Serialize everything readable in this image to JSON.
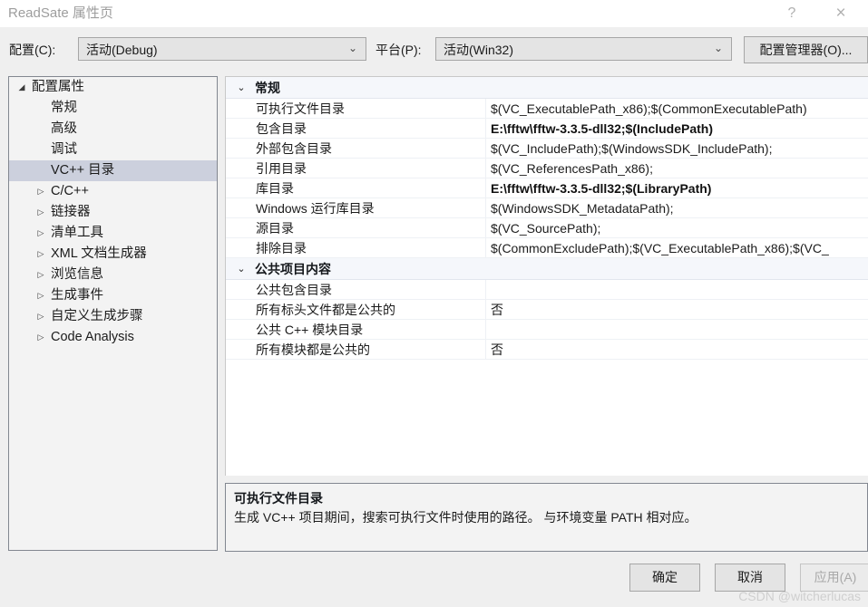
{
  "titlebar": {
    "title": "ReadSate 属性页",
    "help_icon": "?",
    "close_icon": "×"
  },
  "config_bar": {
    "config_label": "配置(C):",
    "config_value": "活动(Debug)",
    "platform_label": "平台(P):",
    "platform_value": "活动(Win32)",
    "config_manager_button": "配置管理器(O)...",
    "chevron": "⌄"
  },
  "tree": {
    "items": [
      {
        "label": "配置属性",
        "level": 0,
        "arrow": "◢",
        "selected": false
      },
      {
        "label": "常规",
        "level": 1,
        "arrow": "",
        "selected": false
      },
      {
        "label": "高级",
        "level": 1,
        "arrow": "",
        "selected": false
      },
      {
        "label": "调试",
        "level": 1,
        "arrow": "",
        "selected": false
      },
      {
        "label": "VC++ 目录",
        "level": 1,
        "arrow": "",
        "selected": true
      },
      {
        "label": "C/C++",
        "level": 2,
        "arrow": "▷",
        "selected": false
      },
      {
        "label": "链接器",
        "level": 2,
        "arrow": "▷",
        "selected": false
      },
      {
        "label": "清单工具",
        "level": 2,
        "arrow": "▷",
        "selected": false
      },
      {
        "label": "XML 文档生成器",
        "level": 2,
        "arrow": "▷",
        "selected": false
      },
      {
        "label": "浏览信息",
        "level": 2,
        "arrow": "▷",
        "selected": false
      },
      {
        "label": "生成事件",
        "level": 2,
        "arrow": "▷",
        "selected": false
      },
      {
        "label": "自定义生成步骤",
        "level": 2,
        "arrow": "▷",
        "selected": false
      },
      {
        "label": "Code Analysis",
        "level": 2,
        "arrow": "▷",
        "selected": false
      }
    ]
  },
  "grid": {
    "groups": [
      {
        "label": "常规",
        "arrow": "⌄",
        "rows": [
          {
            "name": "可执行文件目录",
            "value": "$(VC_ExecutablePath_x86);$(CommonExecutablePath)",
            "bold": false
          },
          {
            "name": "包含目录",
            "value": "E:\\fftw\\fftw-3.3.5-dll32;$(IncludePath)",
            "bold": true
          },
          {
            "name": "外部包含目录",
            "value": "$(VC_IncludePath);$(WindowsSDK_IncludePath);",
            "bold": false
          },
          {
            "name": "引用目录",
            "value": "$(VC_ReferencesPath_x86);",
            "bold": false
          },
          {
            "name": "库目录",
            "value": "E:\\fftw\\fftw-3.3.5-dll32;$(LibraryPath)",
            "bold": true
          },
          {
            "name": "Windows 运行库目录",
            "value": "$(WindowsSDK_MetadataPath);",
            "bold": false
          },
          {
            "name": "源目录",
            "value": "$(VC_SourcePath);",
            "bold": false
          },
          {
            "name": "排除目录",
            "value": "$(CommonExcludePath);$(VC_ExecutablePath_x86);$(VC_",
            "bold": false
          }
        ]
      },
      {
        "label": "公共项目内容",
        "arrow": "⌄",
        "rows": [
          {
            "name": "公共包含目录",
            "value": "",
            "bold": false
          },
          {
            "name": "所有标头文件都是公共的",
            "value": "否",
            "bold": false
          },
          {
            "name": "公共 C++ 模块目录",
            "value": "",
            "bold": false
          },
          {
            "name": "所有模块都是公共的",
            "value": "否",
            "bold": false
          }
        ]
      }
    ]
  },
  "description": {
    "title": "可执行文件目录",
    "body": "生成 VC++ 项目期间，搜索可执行文件时使用的路径。 与环境变量 PATH 相对应。"
  },
  "buttons": {
    "ok": "确定",
    "cancel": "取消",
    "apply": "应用(A)"
  },
  "watermark": "CSDN @witcherlucas"
}
